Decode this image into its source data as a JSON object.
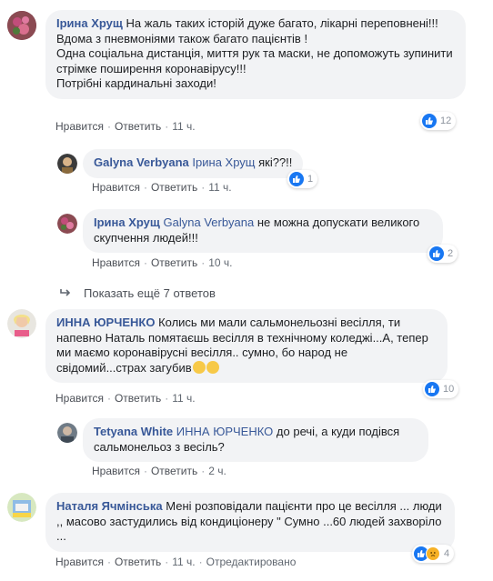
{
  "labels": {
    "like": "Нравится",
    "reply": "Ответить",
    "dot": "·",
    "edited": "Отредактировано"
  },
  "comments": [
    {
      "author": "Ірина Хрущ",
      "text": "На жаль таких історій дуже багато, лікарні переповнені!!!\nВдома з пневмоніями також багато пацієнтів !\nОдна соціальна дистанція, миття рук та маски, не допоможуть зупинити стрімке поширення коронавірусу!!!\nПотрібні кардинальні заходи!",
      "time": "11 ч.",
      "reactions": "12"
    },
    {
      "author": "Galyna Verbyana",
      "mention": "Ірина Хрущ",
      "text": "які??!!",
      "time": "11 ч.",
      "reactions": "1"
    },
    {
      "author": "Ірина Хрущ",
      "mention": "Galyna Verbyana",
      "text": "не можна допускати великого скупчення людей!!!",
      "time": "10 ч.",
      "reactions": "2"
    },
    {
      "author": "ИННА ЮРЧЕНКО",
      "text": "Колись ми мали сальмонельозні весілля, ти напевно Наталь помятаєшь весілля в технічному коледжі...А, тепер ми маємо коронавірусні весілля.. сумно, бо народ не свідомий...страх загубив",
      "time": "11 ч.",
      "reactions": "10"
    },
    {
      "author": "Tetyana White",
      "mention": "ИННА ЮРЧЕНКО",
      "text": "до речі, а куди подівся сальмонельоз з весіль?",
      "time": "2 ч."
    },
    {
      "author": "Наталя Ячмінська",
      "text": "Мені розповідали пацієнти про це весілля ... люди ,, масово застудились від кондиціонеру \" Сумно ...60 людей захворіло ...",
      "time": "11 ч.",
      "reactions": "4"
    }
  ],
  "more_replies": "Показать ещё 7 ответов",
  "colors": {
    "link": "#385898",
    "bubble": "#f2f3f5",
    "like": "#1877f2",
    "sad": "#f7b125"
  }
}
